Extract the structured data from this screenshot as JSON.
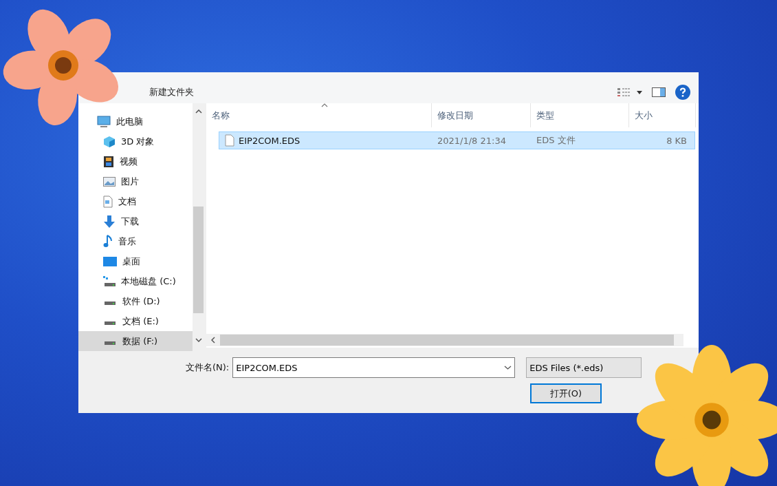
{
  "toolbar": {
    "new_folder": "新建文件夹"
  },
  "nav": {
    "items": [
      {
        "label": "此电脑",
        "kind": "pc",
        "selected": false,
        "children": [
          {
            "label": "3D 对象",
            "kind": "cube",
            "selected": false
          },
          {
            "label": "视频",
            "kind": "film",
            "selected": false
          },
          {
            "label": "图片",
            "kind": "picture",
            "selected": false
          },
          {
            "label": "文档",
            "kind": "document",
            "selected": false
          },
          {
            "label": "下载",
            "kind": "download",
            "selected": false
          },
          {
            "label": "音乐",
            "kind": "music",
            "selected": false
          },
          {
            "label": "桌面",
            "kind": "desktop",
            "selected": false
          },
          {
            "label": "本地磁盘 (C:)",
            "kind": "system-drive",
            "selected": false
          },
          {
            "label": "软件 (D:)",
            "kind": "drive",
            "selected": false
          },
          {
            "label": "文档 (E:)",
            "kind": "drive",
            "selected": false
          },
          {
            "label": "数据 (F:)",
            "kind": "drive",
            "selected": true
          }
        ]
      }
    ]
  },
  "table": {
    "columns": [
      "名称",
      "修改日期",
      "类型",
      "大小"
    ],
    "rows": [
      {
        "name": "EIP2COM.EDS",
        "date": "2021/1/8 21:34",
        "type": "EDS 文件",
        "size": "8 KB",
        "selected": true
      }
    ]
  },
  "footer": {
    "filename_label": "文件名(N):",
    "filename": "EIP2COM.EDS",
    "filter": "EDS Files (*.eds)",
    "open_button": "打开(O)"
  }
}
